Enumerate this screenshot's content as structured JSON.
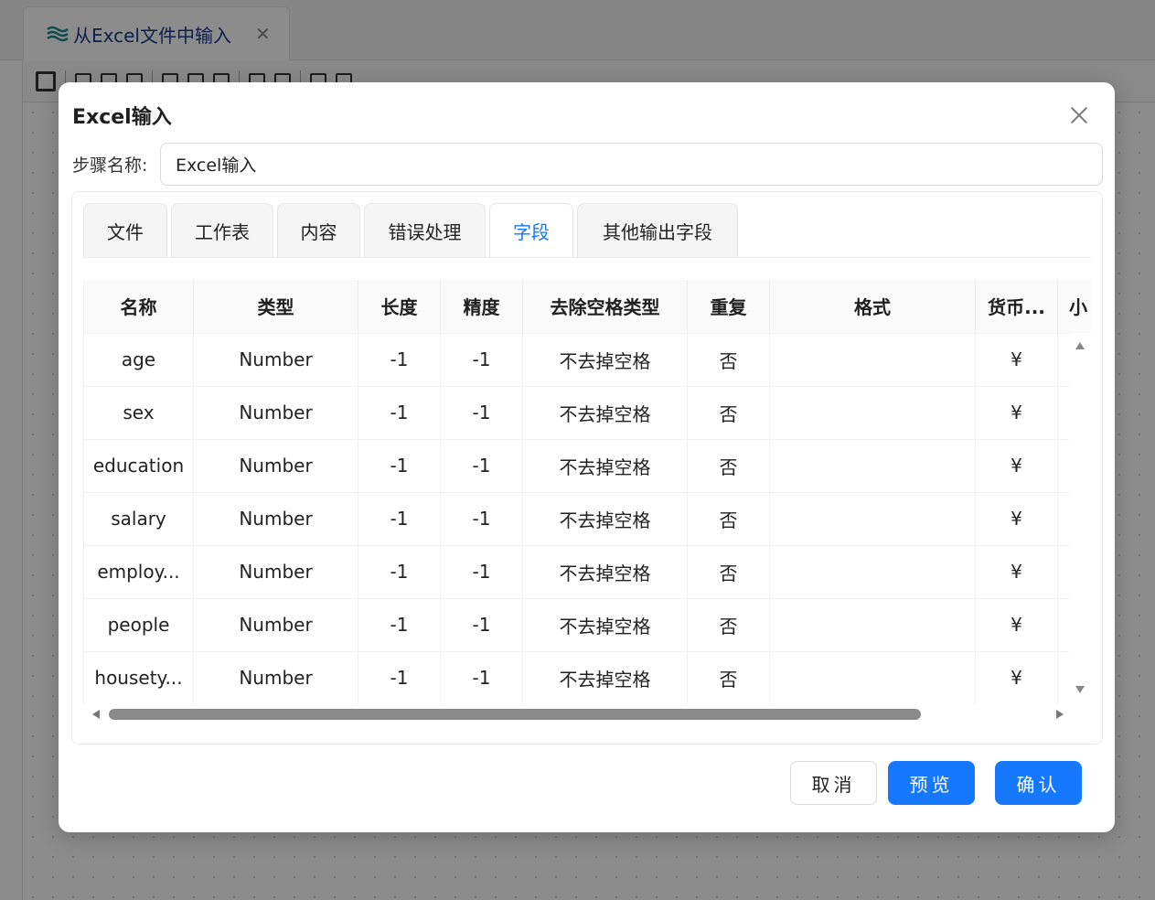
{
  "app": {
    "tab_title": "从Excel文件中输入",
    "tab_close": "✕"
  },
  "dialog": {
    "title": "Excel输入",
    "step_name_label": "步骤名称:",
    "step_name_value": "Excel输入",
    "tabs": [
      {
        "label": "文件"
      },
      {
        "label": "工作表"
      },
      {
        "label": "内容"
      },
      {
        "label": "错误处理"
      },
      {
        "label": "字段",
        "active": true
      },
      {
        "label": "其他输出字段"
      }
    ],
    "table": {
      "columns": [
        "名称",
        "类型",
        "长度",
        "精度",
        "去除空格类型",
        "重复",
        "格式",
        "货币...",
        "小"
      ],
      "rows": [
        [
          "age",
          "Number",
          "-1",
          "-1",
          "不去掉空格",
          "否",
          "",
          "¥",
          ""
        ],
        [
          "sex",
          "Number",
          "-1",
          "-1",
          "不去掉空格",
          "否",
          "",
          "¥",
          ""
        ],
        [
          "education",
          "Number",
          "-1",
          "-1",
          "不去掉空格",
          "否",
          "",
          "¥",
          ""
        ],
        [
          "salary",
          "Number",
          "-1",
          "-1",
          "不去掉空格",
          "否",
          "",
          "¥",
          ""
        ],
        [
          "employ...",
          "Number",
          "-1",
          "-1",
          "不去掉空格",
          "否",
          "",
          "¥",
          ""
        ],
        [
          "people",
          "Number",
          "-1",
          "-1",
          "不去掉空格",
          "否",
          "",
          "¥",
          ""
        ],
        [
          "housety...",
          "Number",
          "-1",
          "-1",
          "不去掉空格",
          "否",
          "",
          "¥",
          ""
        ]
      ]
    },
    "buttons": {
      "cancel": "取消",
      "preview": "预览",
      "confirm": "确认"
    }
  },
  "colors": {
    "primary": "#1677ff",
    "mask": "rgba(0,0,0,0.45)"
  }
}
